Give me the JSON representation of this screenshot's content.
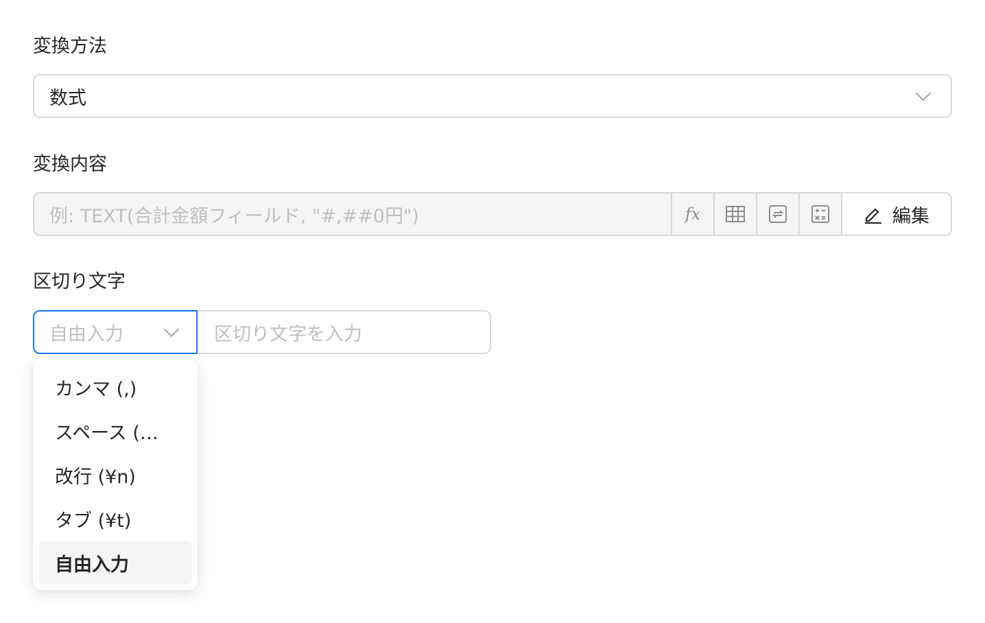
{
  "conversion_method": {
    "label": "変換方法",
    "selected": "数式"
  },
  "conversion_content": {
    "label": "変換内容",
    "placeholder": "例: TEXT(合計金額フィールド, \"#,##0円\")",
    "tools": [
      {
        "icon": "fx-icon",
        "text": "fx"
      },
      {
        "icon": "table-icon"
      },
      {
        "icon": "convert-icon"
      },
      {
        "icon": "calculator-icon"
      }
    ],
    "edit_label": "編集"
  },
  "separator": {
    "label": "区切り文字",
    "selected_placeholder": "自由入力",
    "input_placeholder": "区切り文字を入力",
    "options": [
      "カンマ (,)",
      "スペース (…",
      "改行 (¥n)",
      "タブ (¥t)",
      "自由入力"
    ],
    "selected_index": 4
  },
  "colors": {
    "focus_border": "#1677ff",
    "border": "#d9d9d9",
    "placeholder": "#bfbfbf"
  }
}
